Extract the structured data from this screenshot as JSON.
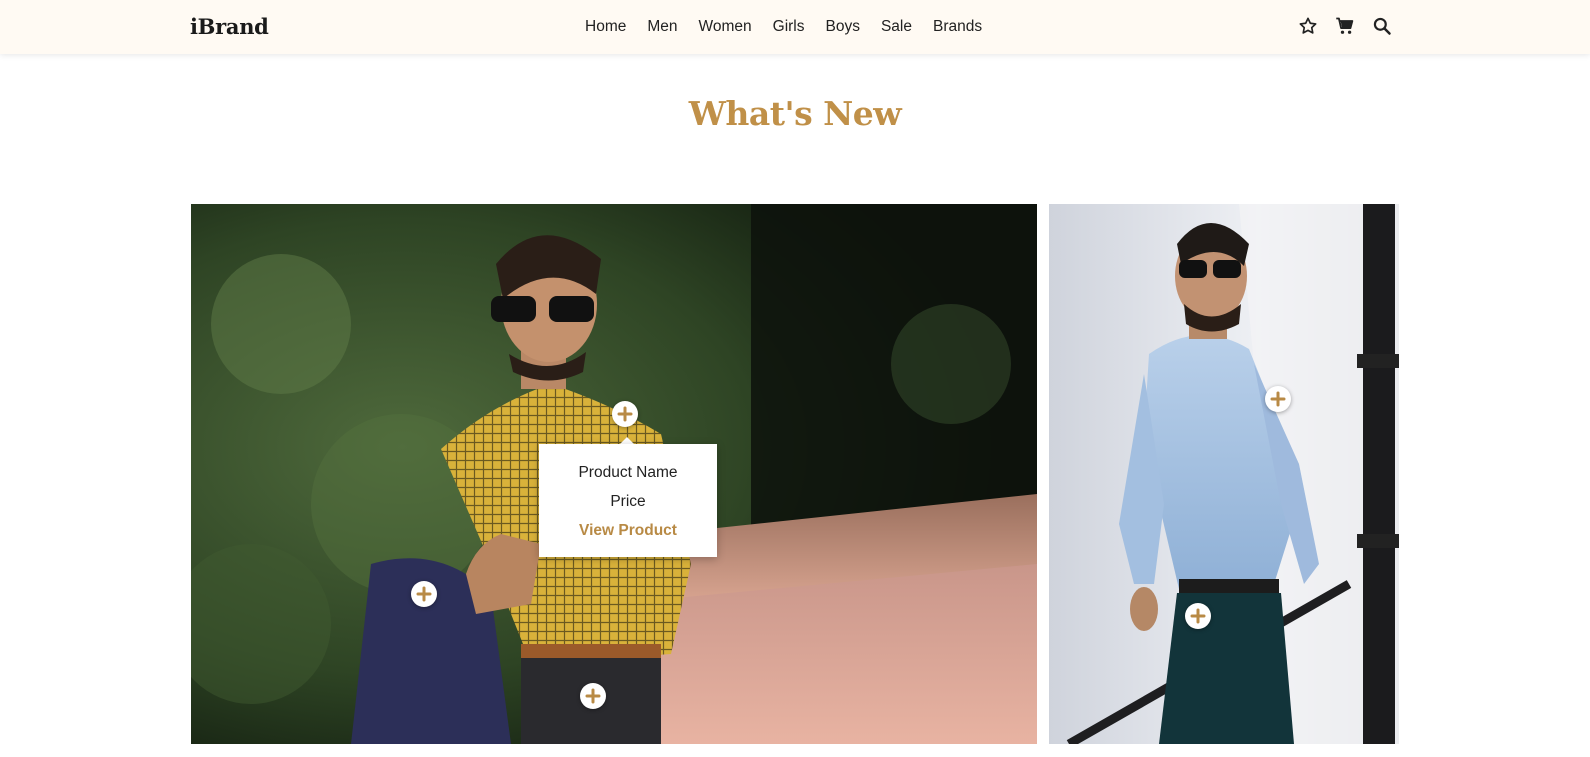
{
  "header": {
    "logo": "iBrand",
    "nav": [
      "Home",
      "Men",
      "Women",
      "Girls",
      "Boys",
      "Sale",
      "Brands"
    ],
    "icons": [
      "star-icon",
      "cart-icon",
      "search-icon"
    ]
  },
  "section": {
    "title": "What's New"
  },
  "popup": {
    "product_name": "Product Name",
    "price": "Price",
    "link": "View Product"
  },
  "colors": {
    "accent": "#c09048",
    "header_bg": "#fffaf3"
  }
}
